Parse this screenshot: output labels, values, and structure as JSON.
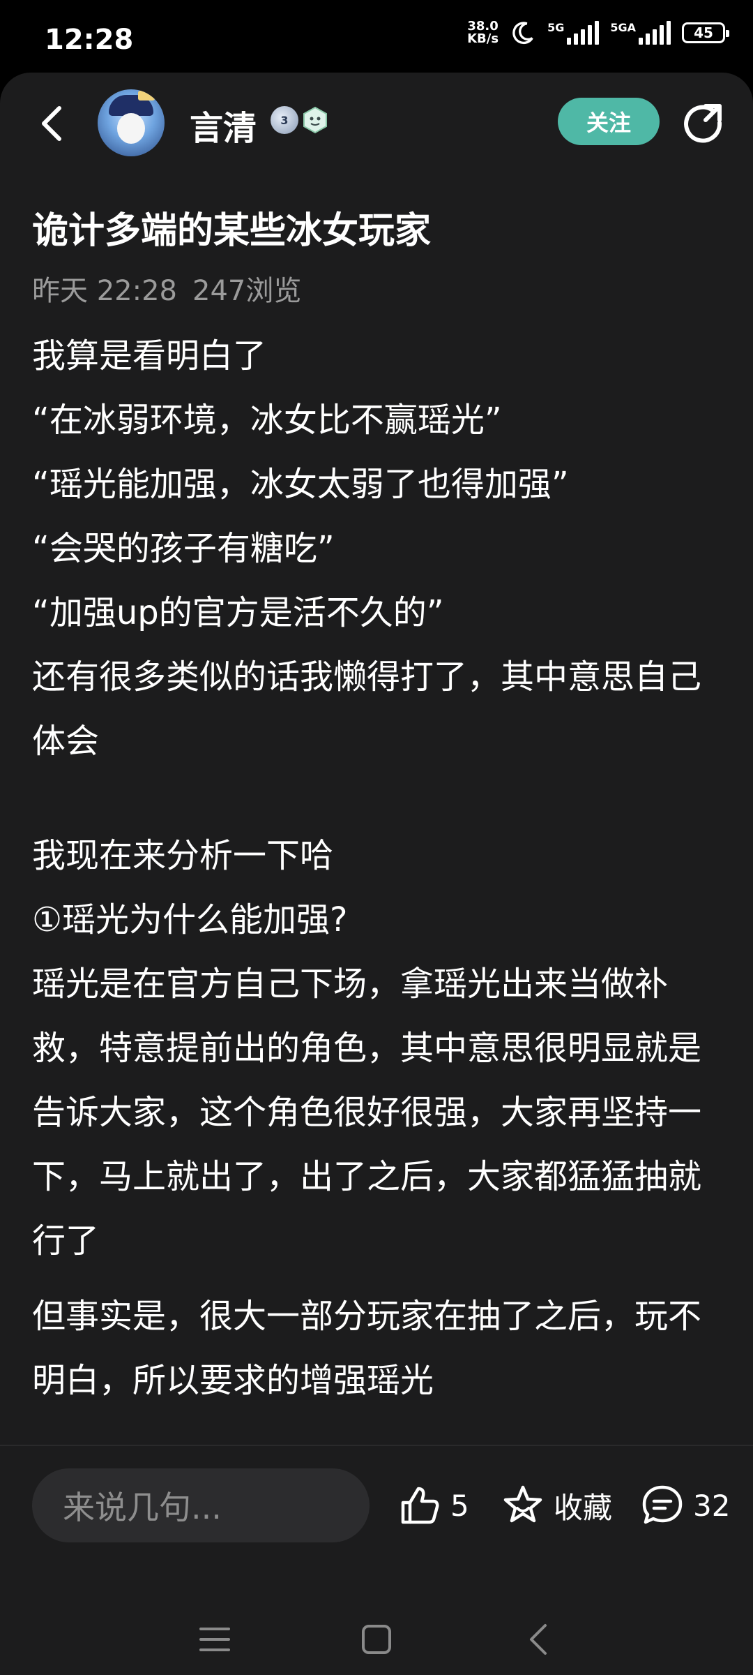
{
  "status_bar": {
    "time": "12:28",
    "net_speed_value": "38.0",
    "net_speed_unit": "KB/s",
    "signal1_label": "5G",
    "signal2_label": "5GA",
    "battery": "45"
  },
  "header": {
    "username": "言清",
    "level_badge": "3",
    "follow_label": "关注"
  },
  "post": {
    "title": "诡计多端的某些冰女玩家",
    "time": "昨天 22:28",
    "views": "247浏览",
    "paragraphs": [
      "我算是看明白了",
      "“在冰弱环境，冰女比不赢瑶光”",
      "“瑶光能加强，冰女太弱了也得加强”",
      "“会哭的孩子有糖吃”",
      "“加强up的官方是活不久的”",
      "还有很多类似的话我懒得打了，其中意思自己体会",
      "我现在来分析一下哈",
      "①瑶光为什么能加强?",
      "瑶光是在官方自己下场，拿瑶光出来当做补救，特意提前出的角色，其中意思很明显就是告诉大家，这个角色很好很强，大家再坚持一下，马上就出了，出了之后，大家都猛猛抽就行了",
      "但事实是，很大一部分玩家在抽了之后，玩不明白，所以要求的增强瑶光"
    ]
  },
  "actions": {
    "comment_placeholder": "来说几句...",
    "like_count": "5",
    "favorite_label": "收藏",
    "comment_count": "32"
  },
  "colors": {
    "background": "#1c1c1d",
    "accent": "#4fb8a6",
    "meta_text": "#9b9b9b"
  },
  "icons": [
    "back-arrow-icon",
    "avatar",
    "share-icon",
    "thumbs-up-icon",
    "star-icon",
    "comment-bubble-icon",
    "menu-icon",
    "home-square-icon",
    "nav-back-icon"
  ]
}
